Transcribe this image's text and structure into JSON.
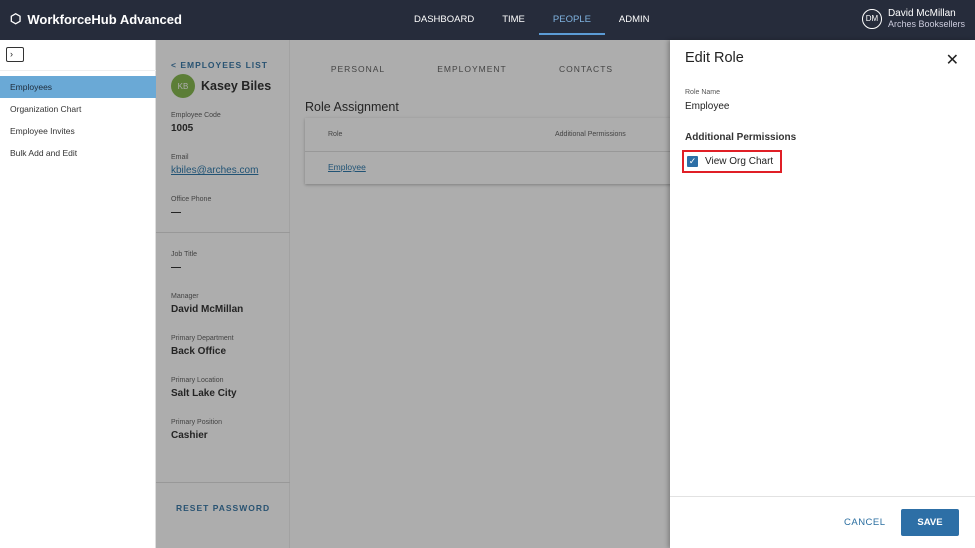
{
  "app": {
    "title": "WorkforceHub Advanced"
  },
  "nav": [
    "DASHBOARD",
    "TIME",
    "PEOPLE",
    "ADMIN"
  ],
  "user": {
    "initials": "DM",
    "name": "David McMillan",
    "org": "Arches Booksellers"
  },
  "sidebar": [
    "Employees",
    "Organization Chart",
    "Employee Invites",
    "Bulk Add and Edit"
  ],
  "employee": {
    "back": "< EMPLOYEES LIST",
    "initials": "KB",
    "name": "Kasey Biles",
    "fields": [
      {
        "label": "Employee Code",
        "value": "1005"
      },
      {
        "label": "Email",
        "value": "kbiles@arches.com"
      },
      {
        "label": "Office Phone",
        "value": "—"
      },
      {
        "label": "Job Title",
        "value": "—"
      },
      {
        "label": "Manager",
        "value": "David McMillan"
      },
      {
        "label": "Primary Department",
        "value": "Back Office"
      },
      {
        "label": "Primary Location",
        "value": "Salt Lake City"
      },
      {
        "label": "Primary Position",
        "value": "Cashier"
      }
    ],
    "reset": "RESET PASSWORD"
  },
  "tabs": [
    "PERSONAL",
    "EMPLOYMENT",
    "CONTACTS"
  ],
  "roles": {
    "title": "Role Assignment",
    "col_role": "Role",
    "col_perm": "Additional Permissions",
    "row_role": "Employee"
  },
  "drawer": {
    "title": "Edit Role",
    "role_label": "Role Name",
    "role_value": "Employee",
    "perm_title": "Additional Permissions",
    "perm": "View Org Chart",
    "perm_checked": true,
    "cancel": "CANCEL",
    "save": "SAVE"
  }
}
